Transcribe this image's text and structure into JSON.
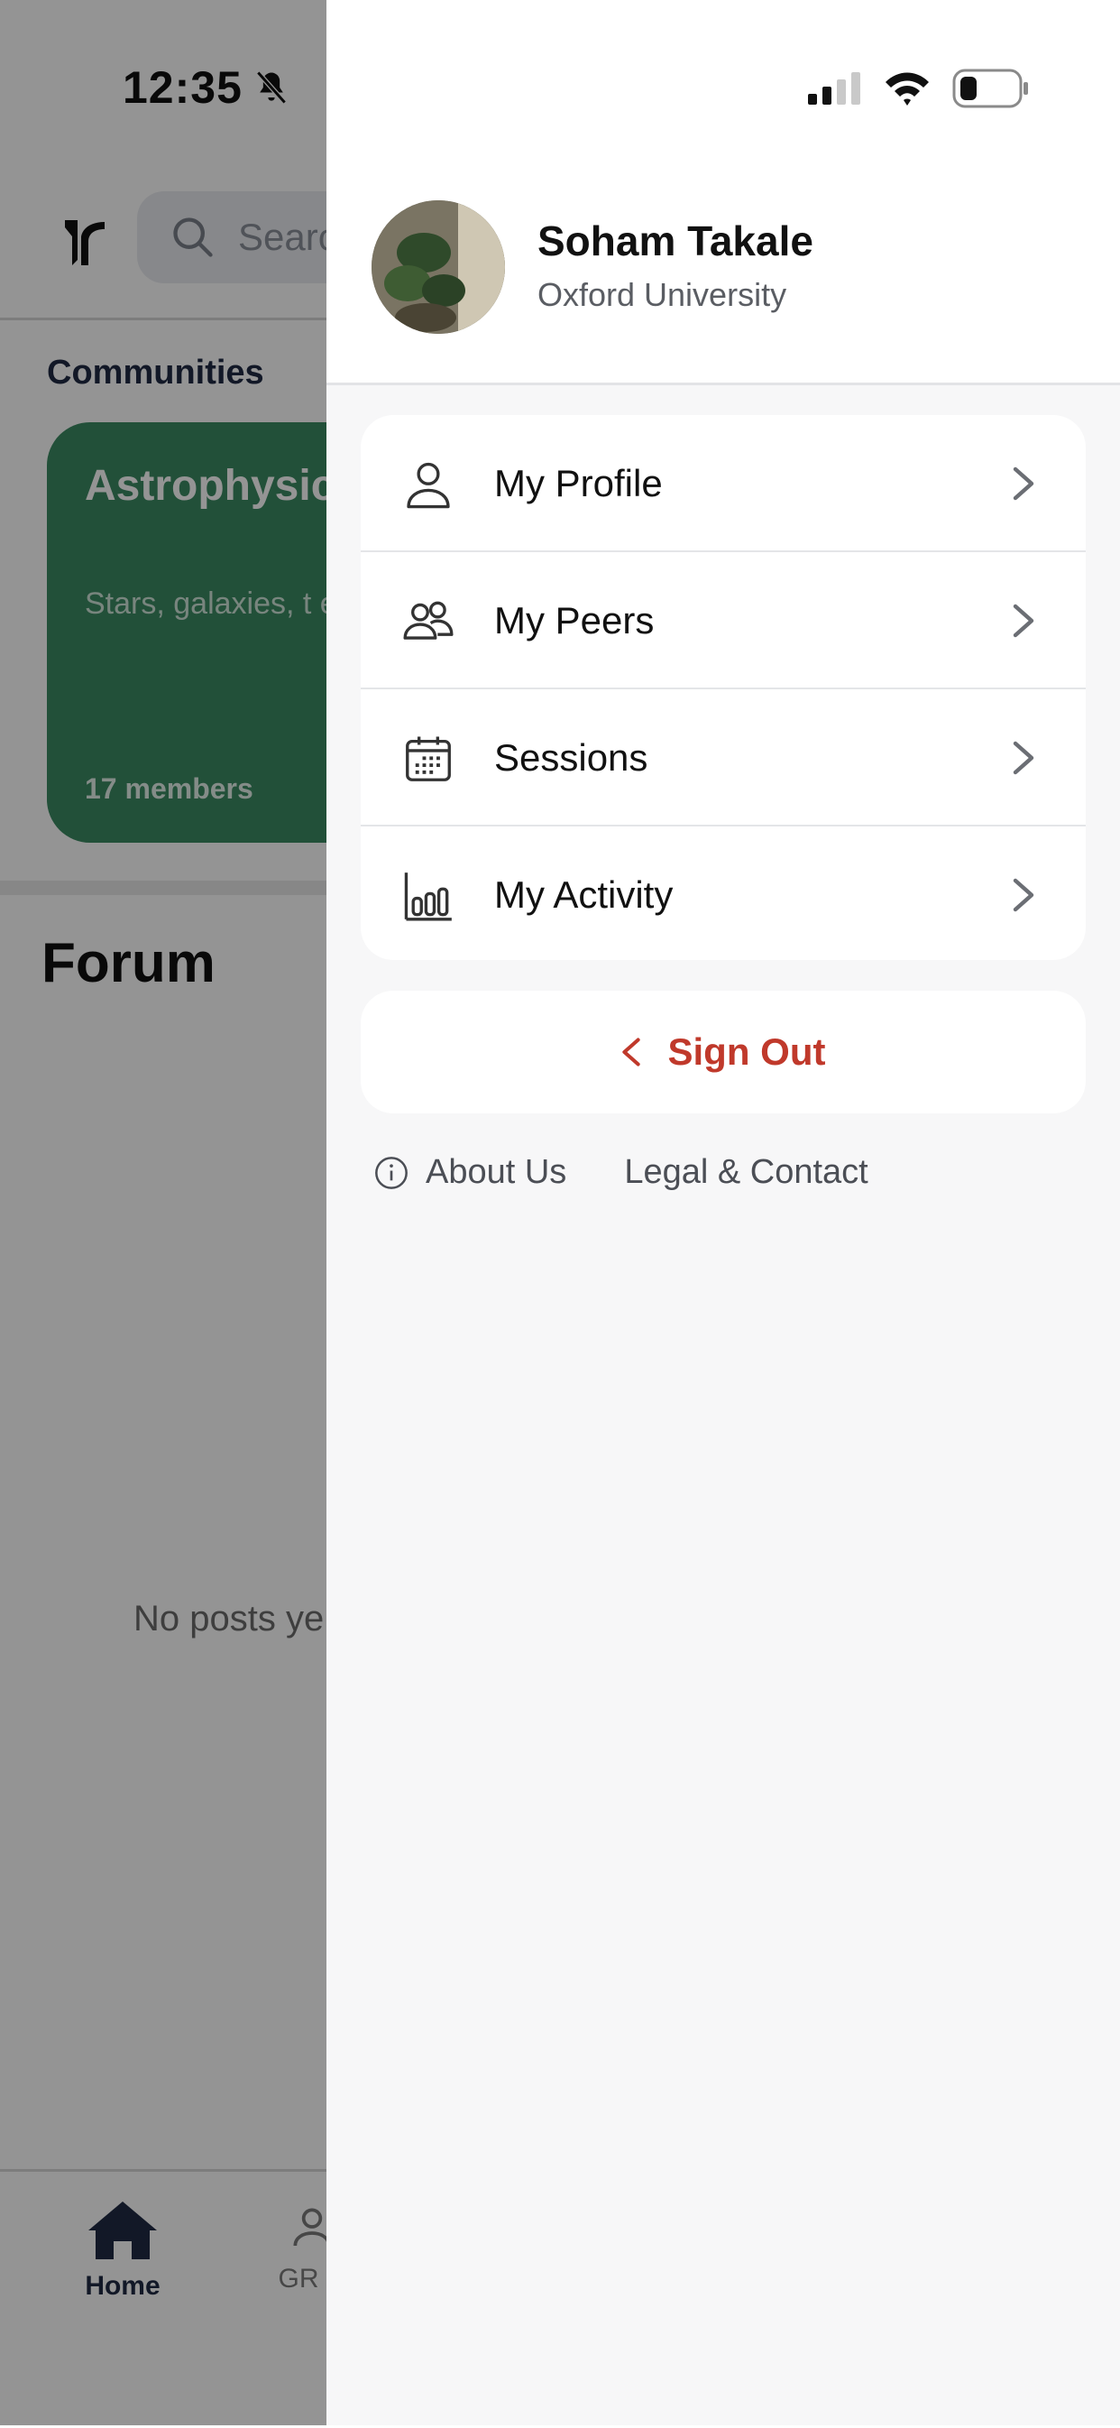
{
  "status_bar": {
    "time": "12:35"
  },
  "background_app": {
    "search_placeholder": "Searc",
    "communities_label": "Communities",
    "community_card": {
      "title": "Astrophysic Cosmology",
      "description": "Stars, galaxies, t early universe, a",
      "members": "17 members"
    },
    "forum_title": "Forum",
    "no_posts_text": "No posts ye",
    "tabs": [
      {
        "label": "Home",
        "icon": "home-icon"
      },
      {
        "label": "GR N",
        "icon": "person-icon"
      }
    ]
  },
  "drawer": {
    "user": {
      "name": "Soham Takale",
      "school": "Oxford University"
    },
    "menu": [
      {
        "label": "My Profile",
        "icon": "person-icon"
      },
      {
        "label": "My Peers",
        "icon": "peers-icon"
      },
      {
        "label": "Sessions",
        "icon": "calendar-icon"
      },
      {
        "label": "My Activity",
        "icon": "bar-chart-icon"
      }
    ],
    "sign_out_label": "Sign Out",
    "footer": {
      "about": "About Us",
      "legal": "Legal & Contact"
    }
  },
  "colors": {
    "accent_red": "#c0392b",
    "card_green": "#3b8a62",
    "navy": "#1f2a44"
  }
}
